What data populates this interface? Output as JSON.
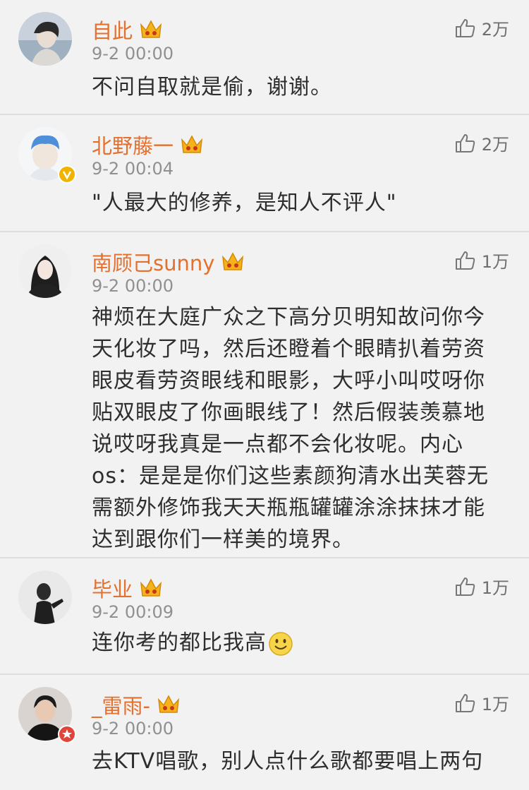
{
  "comments": [
    {
      "username": "自此",
      "timestamp": "9-2 00:00",
      "likes": "2万",
      "text": "不问自取就是偷，谢谢。",
      "verified": false
    },
    {
      "username": "北野藤一",
      "timestamp": "9-2 00:04",
      "likes": "2万",
      "text": "\"人最大的修养，是知人不评人\"",
      "verified": true,
      "badge_color": "#f0b400"
    },
    {
      "username": "南顾己sunny",
      "timestamp": "9-2 00:00",
      "likes": "1万",
      "text": "神烦在大庭广众之下高分贝明知故问你今天化妆了吗，然后还瞪着个眼睛扒着劳资眼皮看劳资眼线和眼影，大呼小叫哎呀你贴双眼皮了你画眼线了！然后假装羡慕地说哎呀我真是一点都不会化妆呢。内心os：是是是你们这些素颜狗清水出芙蓉无需额外修饰我天天瓶瓶罐罐涂涂抹抹才能达到跟你们一样美的境界。",
      "verified": false
    },
    {
      "username": "毕业",
      "timestamp": "9-2 00:09",
      "likes": "1万",
      "text": "连你考的都比我高",
      "emoji": "smile-emoji",
      "verified": false
    },
    {
      "username": "_雷雨-",
      "timestamp": "9-2 00:00",
      "likes": "1万",
      "text": "去KTV唱歌，别人点什么歌都要唱上两句",
      "verified": true,
      "badge_color": "#e0443a"
    }
  ],
  "colors": {
    "username": "#e4702e",
    "text": "#2e2e2e",
    "timestamp": "#909090",
    "background": "#f2f2f2"
  },
  "icons": {
    "like": "thumbs-up-icon",
    "vip": "crown-icon"
  }
}
